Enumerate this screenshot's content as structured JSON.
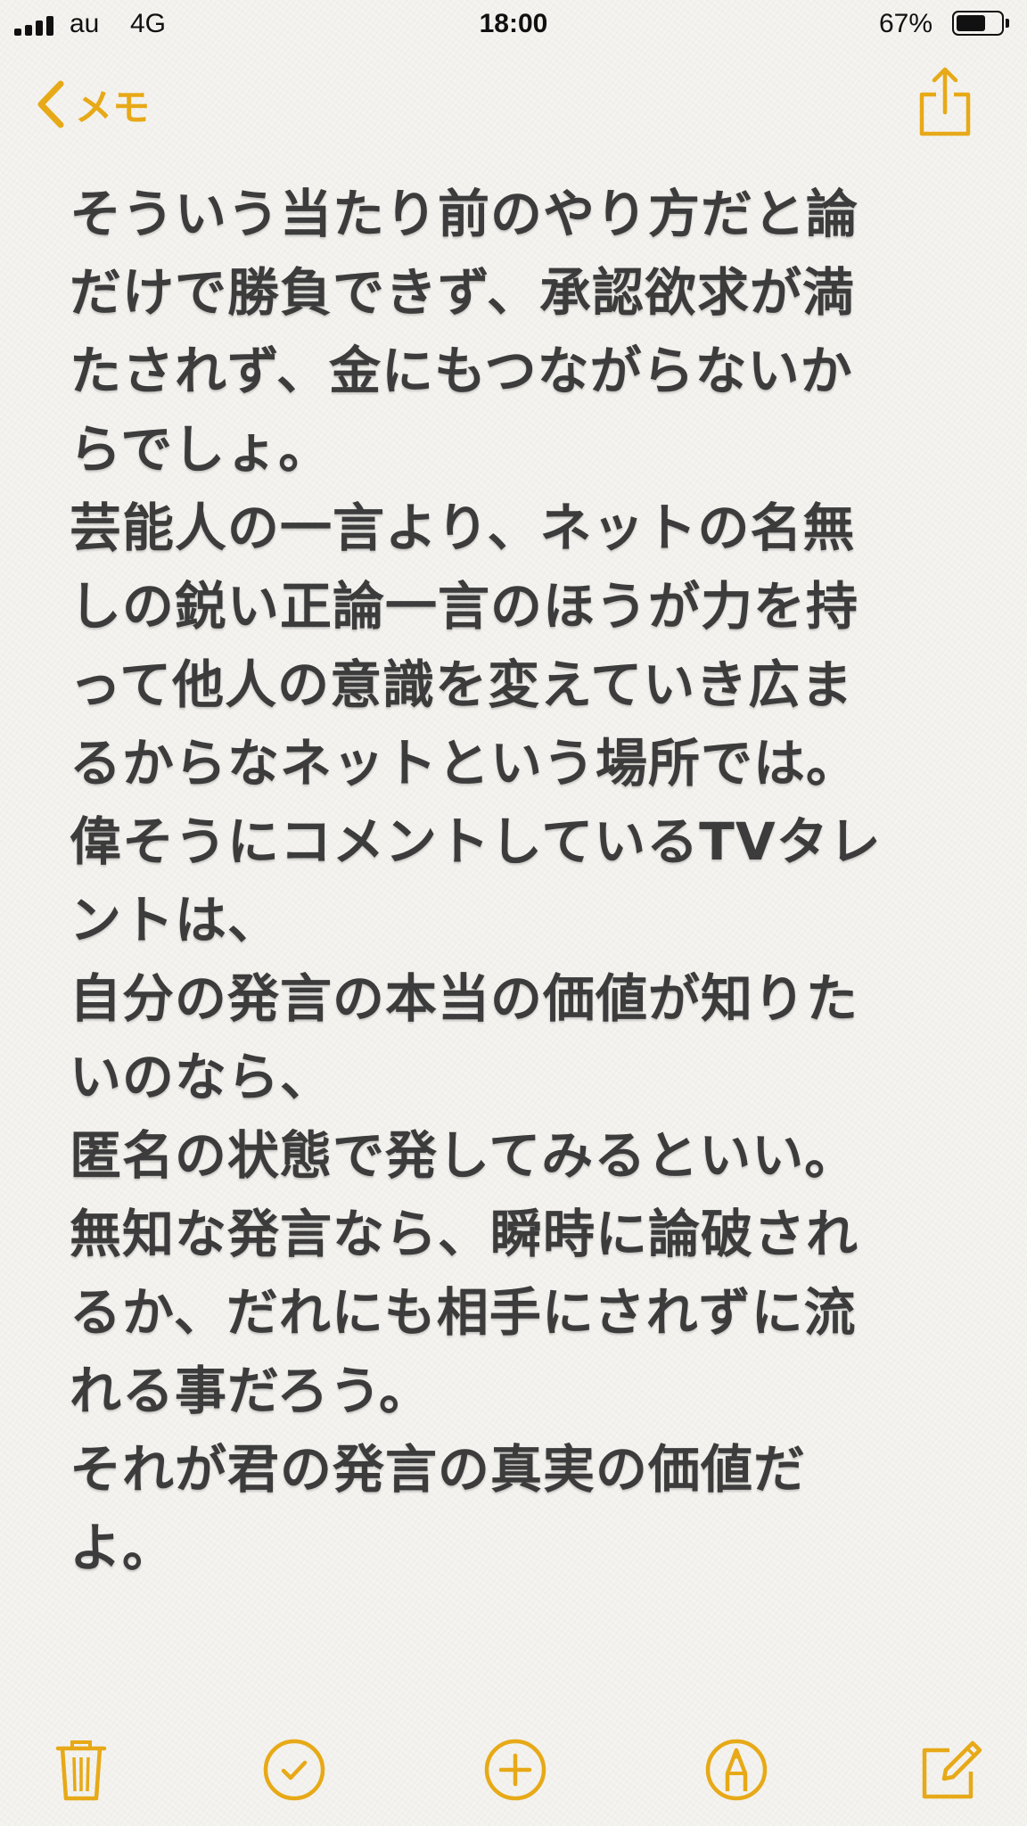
{
  "status_bar": {
    "carrier": "au",
    "network": "4G",
    "time": "18:00",
    "battery_percent_text": "67%",
    "battery_level": 0.67
  },
  "nav": {
    "back_label": "メモ",
    "back_icon": "chevron-left-icon",
    "share_icon": "share-icon"
  },
  "note": {
    "lines": [
      "そういう当たり前のやり方だと論",
      "だけで勝負できず、承認欲求が満",
      "たされず、金にもつながらないか",
      "らでしょ。",
      "芸能人の一言より、ネットの名無",
      "しの鋭い正論一言のほうが力を持",
      "って他人の意識を変えていき広ま",
      "るからなネットという場所では。",
      "偉そうにコメントしているTVタレ",
      "ントは、",
      "自分の発言の本当の価値が知りた",
      "いのなら、",
      "匿名の状態で発してみるといい。",
      "無知な発言なら、瞬時に論破され",
      "るか、だれにも相手にされずに流",
      "れる事だろう。",
      "それが君の発言の真実の価値だ",
      "よ。"
    ]
  },
  "toolbar": {
    "icons": [
      "trash-icon",
      "checklist-icon",
      "add-icon",
      "markup-icon",
      "compose-icon"
    ]
  },
  "colors": {
    "accent": "#e7a917",
    "text": "#3c3c3c",
    "background": "#f2f1ed"
  }
}
